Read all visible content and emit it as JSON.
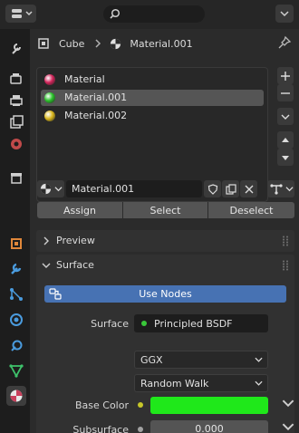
{
  "header": {
    "object_name": "Cube",
    "material_name": "Material.001"
  },
  "material_slots": [
    {
      "name": "Material",
      "color": "#d2245a"
    },
    {
      "name": "Material.001",
      "color": "#2ac12a"
    },
    {
      "name": "Material.002",
      "color": "#d8b51b"
    }
  ],
  "selected_slot": 1,
  "material_field": {
    "value": "Material.001"
  },
  "slot_buttons": {
    "assign": "Assign",
    "select": "Select",
    "deselect": "Deselect"
  },
  "panels": {
    "preview": "Preview",
    "surface": "Surface"
  },
  "use_nodes": "Use Nodes",
  "surface": {
    "label": "Surface",
    "shader": "Principled BSDF",
    "distribution": "GGX",
    "subsurface_method": "Random Walk",
    "base_color_label": "Base Color",
    "base_color": "#1fe81a",
    "subsurface_label": "Subsurface",
    "subsurface_value": "0.000"
  },
  "colors": {
    "accent": "#4772b3",
    "panel": "#2b2b2b",
    "field": "#1d1d1d"
  }
}
